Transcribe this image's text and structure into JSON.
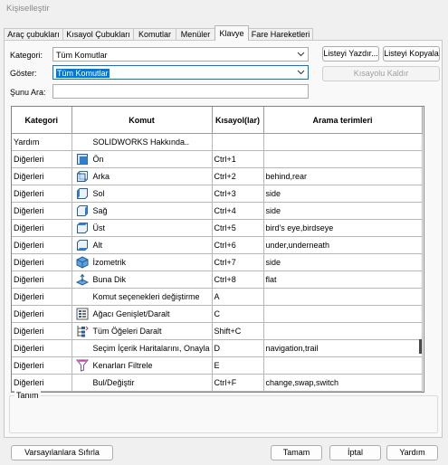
{
  "window": {
    "title": "Kişiselleştir"
  },
  "tabs": [
    {
      "label": "Araç çubukları"
    },
    {
      "label": "Kısayol Çubukları"
    },
    {
      "label": "Komutlar"
    },
    {
      "label": "Menüler"
    },
    {
      "label": "Klavye",
      "active": true
    },
    {
      "label": "Fare Hareketleri"
    }
  ],
  "filters": {
    "category_label": "Kategori:",
    "category_value": "Tüm Komutlar",
    "show_label": "Göster:",
    "show_value": "Tüm Komutlar",
    "search_label": "Şunu Ara:",
    "search_value": ""
  },
  "buttons": {
    "print_list": "Listeyi Yazdır...",
    "copy_list": "Listeyi Kopyala",
    "remove_shortcut": "Kısayolu Kaldır",
    "reset_defaults": "Varsayılanlara Sıfırla",
    "ok": "Tamam",
    "cancel": "İptal",
    "help": "Yardım"
  },
  "table": {
    "headers": [
      "Kategori",
      "Komut",
      "Kısayol(lar)",
      "Arama terimleri"
    ],
    "rows": [
      {
        "category": "Yardım",
        "icon": "",
        "command": "SOLIDWORKS Hakkında..",
        "shortcut": "",
        "terms": ""
      },
      {
        "category": "Diğerleri",
        "icon": "view-front-icon",
        "command": "Ön",
        "shortcut": "Ctrl+1",
        "terms": ""
      },
      {
        "category": "Diğerleri",
        "icon": "view-back-icon",
        "command": "Arka",
        "shortcut": "Ctrl+2",
        "terms": "behind,rear"
      },
      {
        "category": "Diğerleri",
        "icon": "view-left-icon",
        "command": "Sol",
        "shortcut": "Ctrl+3",
        "terms": "side"
      },
      {
        "category": "Diğerleri",
        "icon": "view-right-icon",
        "command": "Sağ",
        "shortcut": "Ctrl+4",
        "terms": "side"
      },
      {
        "category": "Diğerleri",
        "icon": "view-top-icon",
        "command": "Üst",
        "shortcut": "Ctrl+5",
        "terms": "bird's eye,birdseye"
      },
      {
        "category": "Diğerleri",
        "icon": "view-bottom-icon",
        "command": "Alt",
        "shortcut": "Ctrl+6",
        "terms": "under,underneath"
      },
      {
        "category": "Diğerleri",
        "icon": "isometric-icon",
        "command": "İzometrik",
        "shortcut": "Ctrl+7",
        "terms": "side"
      },
      {
        "category": "Diğerleri",
        "icon": "normal-to-icon",
        "command": "Buna Dik",
        "shortcut": "Ctrl+8",
        "terms": "flat"
      },
      {
        "category": "Diğerleri",
        "icon": "",
        "command": "Komut seçenekleri değiştirme",
        "shortcut": "A",
        "terms": ""
      },
      {
        "category": "Diğerleri",
        "icon": "tree-expand-icon",
        "command": "Ağacı Genişlet/Daralt",
        "shortcut": "C",
        "terms": ""
      },
      {
        "category": "Diğerleri",
        "icon": "collapse-all-icon",
        "command": "Tüm Öğeleri Daralt",
        "shortcut": "Shift+C",
        "terms": ""
      },
      {
        "category": "Diğerleri",
        "icon": "",
        "command": "Seçim İçerik Haritalarını, Onayla",
        "shortcut": "D",
        "terms": "navigation,trail"
      },
      {
        "category": "Diğerleri",
        "icon": "filter-edges-icon",
        "command": "Kenarları Filtrele",
        "shortcut": "E",
        "terms": ""
      },
      {
        "category": "Diğerleri",
        "icon": "",
        "command": "Bul/Değiştir",
        "shortcut": "Ctrl+F",
        "terms": "change,swap,switch"
      }
    ]
  },
  "description": {
    "label": "Tanım"
  }
}
